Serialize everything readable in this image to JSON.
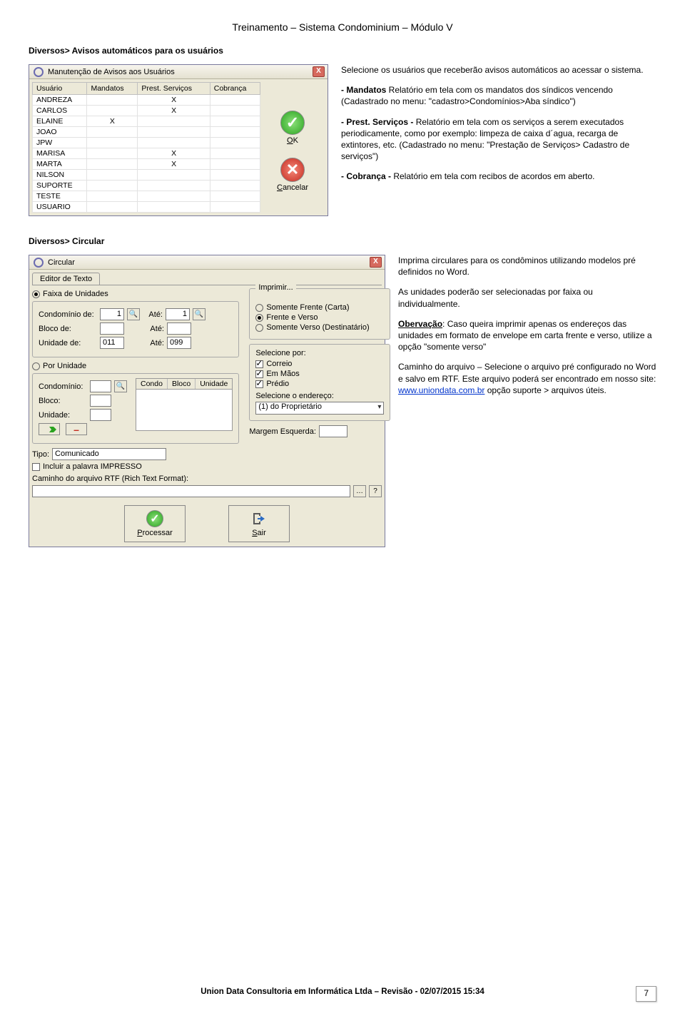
{
  "doc": {
    "header": "Treinamento – Sistema Condominium – Módulo V",
    "footer": "Union Data Consultoria em Informática Ltda – Revisão - 02/07/2015 15:34",
    "page_number": "7"
  },
  "section1": {
    "breadcrumb": "Diversos> Avisos automáticos para os usuários",
    "desc": {
      "p1": "Selecione os usuários que receberão avisos automáticos ao acessar o sistema.",
      "p2a": "- Mandatos",
      "p2b": " Relatório em tela com os mandatos dos síndicos vencendo (Cadastrado no menu: \"cadastro>Condomínios>Aba síndico\")",
      "p3a": "- Prest. Serviços - ",
      "p3b": "Relatório em tela com os serviços a serem executados periodicamente, como por exemplo: limpeza de caixa d´agua, recarga de extintores, etc. (Cadastrado no menu: \"Prestação de Serviços> Cadastro de serviços\")",
      "p4a": "- Cobrança - ",
      "p4b": "Relatório em tela com recibos de acordos em aberto."
    },
    "dialog": {
      "title": "Manutenção de Avisos aos Usuários",
      "columns": [
        "Usuário",
        "Mandatos",
        "Prest. Serviços",
        "Cobrança"
      ],
      "rows": [
        {
          "u": "ANDREZA",
          "m": "",
          "p": "X",
          "c": ""
        },
        {
          "u": "CARLOS",
          "m": "",
          "p": "X",
          "c": ""
        },
        {
          "u": "ELAINE",
          "m": "X",
          "p": "",
          "c": ""
        },
        {
          "u": "JOAO",
          "m": "",
          "p": "",
          "c": ""
        },
        {
          "u": "JPW",
          "m": "",
          "p": "",
          "c": ""
        },
        {
          "u": "MARISA",
          "m": "",
          "p": "X",
          "c": ""
        },
        {
          "u": "MARTA",
          "m": "",
          "p": "X",
          "c": ""
        },
        {
          "u": "NILSON",
          "m": "",
          "p": "",
          "c": ""
        },
        {
          "u": "SUPORTE",
          "m": "",
          "p": "",
          "c": ""
        },
        {
          "u": "TESTE",
          "m": "",
          "p": "",
          "c": ""
        },
        {
          "u": "USUARIO",
          "m": "",
          "p": "",
          "c": ""
        }
      ],
      "ok": "OK",
      "cancel": "Cancelar"
    }
  },
  "section2": {
    "breadcrumb": "Diversos> Circular",
    "desc": {
      "p1": "Imprima circulares para os condôminos utilizando modelos pré definidos no Word.",
      "p2": "As unidades poderão ser selecionadas por faixa ou individualmente.",
      "p3a": "Obervação",
      "p3b": ": Caso queira imprimir apenas os endereços das unidades em formato de envelope em carta frente e verso, utilize a opção \"somente verso\"",
      "p4a": "Caminho do arquivo – Selecione o arquivo pré configurado no Word e salvo em RTF. Este arquivo poderá ser encontrado em nosso site: ",
      "p4link": "www.uniondata.com.br",
      "p4b": " opção suporte > arquivos úteis."
    },
    "dialog": {
      "title": "Circular",
      "tab": "Editor de Texto",
      "left": {
        "grp_faixa": "Faixa de Unidades",
        "cond_de_lbl": "Condomínio de:",
        "cond_de_val": "1",
        "ate_lbl": "Até:",
        "cond_ate_val": "1",
        "bloco_de_lbl": "Bloco de:",
        "bloco_de_val": "",
        "bloco_ate_val": "",
        "unid_de_lbl": "Unidade de:",
        "unid_de_val": "011",
        "unid_ate_val": "099",
        "grp_porunidade": "Por Unidade",
        "cond_lbl": "Condomínio:",
        "bloco_lbl": "Bloco:",
        "unid_lbl": "Unidade:",
        "hdr_condo": "Condo",
        "hdr_bloco": "Bloco",
        "hdr_unid": "Unidade",
        "tipo_lbl": "Tipo:",
        "tipo_val": "Comunicado",
        "incluir_lbl": "Incluir a palavra IMPRESSO",
        "caminho_lbl": "Caminho do arquivo RTF (Rich Text Format):"
      },
      "right": {
        "imprimir_legend": "Imprimir...",
        "opt_frente": "Somente Frente (Carta)",
        "opt_fv": "Frente e Verso",
        "opt_verso": "Somente Verso (Destinatário)",
        "selpor_lbl": "Selecione por:",
        "cb_correio": "Correio",
        "cb_emmaos": "Em Mãos",
        "cb_predio": "Prédio",
        "selend_lbl": "Selecione o endereço:",
        "selend_val": "(1) do Proprietário",
        "margem_lbl": "Margem Esquerda:"
      },
      "btn_processar": "Processar",
      "btn_sair": "Sair",
      "btn_help": "?"
    }
  }
}
